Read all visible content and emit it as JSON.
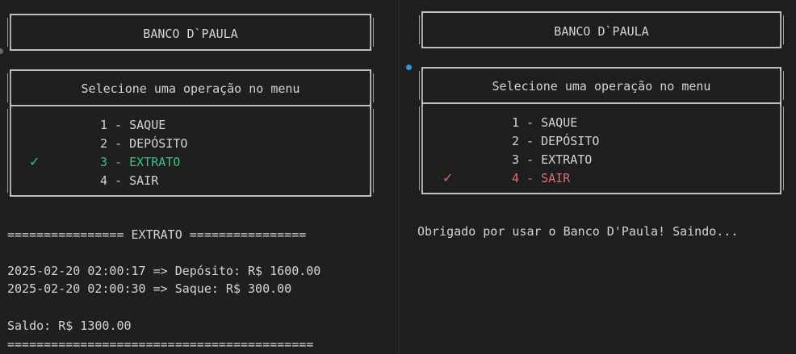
{
  "colors": {
    "background": "#1e1e1e",
    "text": "#d4d4d4",
    "border": "#bfbfbf",
    "selected_left": "#3fbf88",
    "selected_right": "#e06c6c",
    "gutter_dot": "#3794d6"
  },
  "left": {
    "title": "BANCO D`PAULA",
    "prompt": "Selecione uma operação no menu",
    "menu": [
      "1 - SAQUE",
      "2 - DEPÓSITO",
      "3 - EXTRATO",
      "4 - SAIR"
    ],
    "selected_index": 2,
    "check_icon": "✓",
    "extrato_header": "================ EXTRATO ================",
    "transactions": [
      "2025-02-20 02:00:17 => Depósito: R$ 1600.00",
      "2025-02-20 02:00:30 => Saque: R$ 300.00"
    ],
    "saldo": "Saldo: R$ 1300.00",
    "footer_rule": "=========================================="
  },
  "right": {
    "title": "BANCO D`PAULA",
    "prompt": "Selecione uma operação no menu",
    "menu": [
      "1 - SAQUE",
      "2 - DEPÓSITO",
      "3 - EXTRATO",
      "4 - SAIR"
    ],
    "selected_index": 3,
    "check_icon": "✓",
    "goodbye": "Obrigado por usar o Banco D'Paula! Saindo..."
  }
}
